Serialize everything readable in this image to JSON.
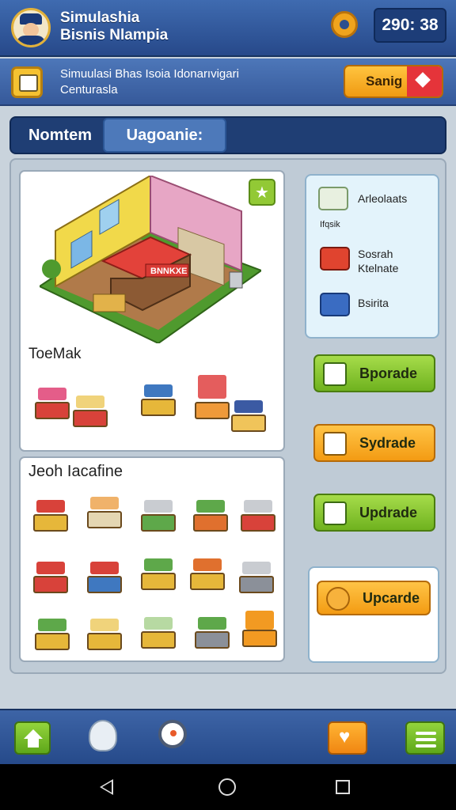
{
  "header": {
    "title_line1": "Simulashia",
    "title_line2": "Bisnis Nlampia",
    "timer": "290: 38"
  },
  "banner": {
    "text_line1": "Simuulasi Bhas Isoia Idonarıvigari",
    "text_line2": "Centurasla",
    "save_label": "Sanig"
  },
  "tabs": {
    "tab1": "Nomtem",
    "tab2": "Uagoanie:"
  },
  "store": {
    "sign": "BNNKXE",
    "shop_label": "ToeMak",
    "section2_label": "Jeoh Iacafine"
  },
  "side": {
    "items": [
      {
        "label": "Arleolaats",
        "sub": "Ifqsik"
      },
      {
        "label": "Sosrah",
        "sub": "Ktelnate"
      },
      {
        "label": "Bsirita",
        "sub": ""
      }
    ],
    "buttons": [
      "Bporade",
      "Sydrade",
      "Updrade",
      "Upcarde"
    ]
  },
  "colors": {
    "header": "#2d4f8e",
    "accent_orange": "#f39b13",
    "accent_green": "#6fb21f",
    "panel": "#bfcbd6"
  }
}
